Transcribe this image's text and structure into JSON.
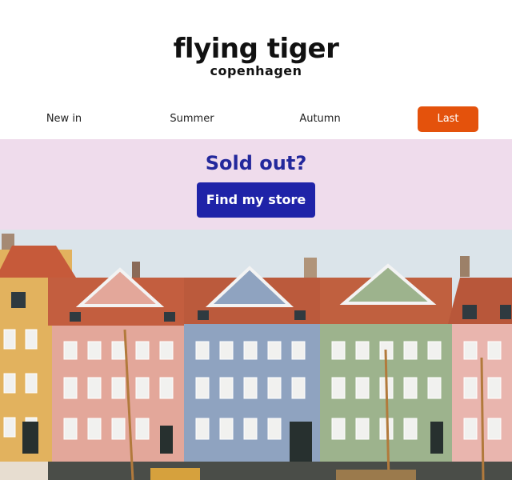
{
  "logo": {
    "main": "flying tiger",
    "sub": "copenhagen"
  },
  "nav": {
    "items": [
      {
        "label": "New in"
      },
      {
        "label": "Summer"
      },
      {
        "label": "Autumn"
      },
      {
        "label": "Last chance"
      }
    ]
  },
  "promo": {
    "title": "Sold out?",
    "button": "Find my store"
  },
  "colors": {
    "accent": "#e4520c",
    "brand_blue": "#1f23a8",
    "promo_bg": "#efdcec"
  }
}
